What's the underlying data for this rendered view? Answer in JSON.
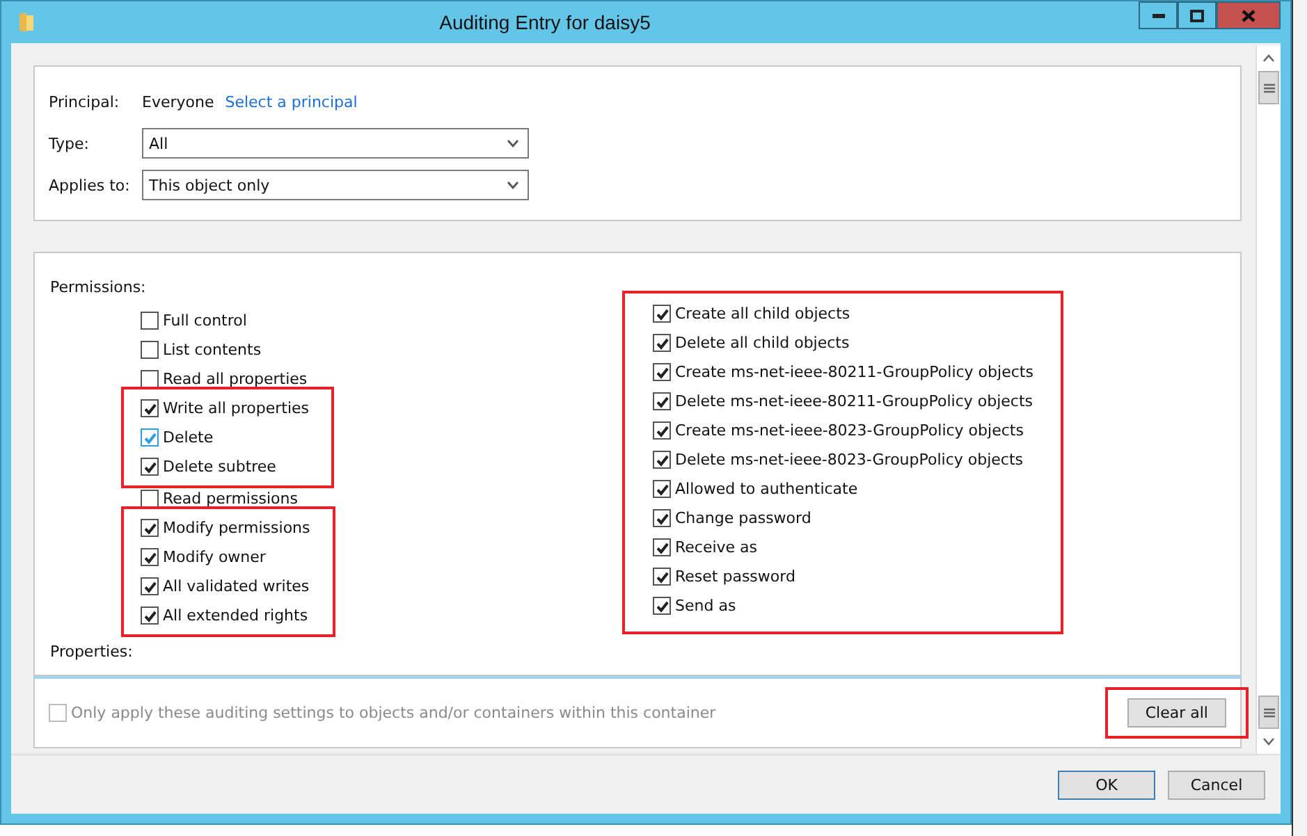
{
  "window": {
    "title": "Auditing Entry for daisy5"
  },
  "principal": {
    "label": "Principal:",
    "value": "Everyone",
    "link": "Select a principal"
  },
  "type": {
    "label": "Type:",
    "value": "All"
  },
  "applies_to": {
    "label": "Applies to:",
    "value": "This object only"
  },
  "permissions": {
    "heading": "Permissions:",
    "left_groups": [
      {
        "highlighted": false,
        "items": [
          {
            "label": "Full control",
            "checked": false,
            "focused": false
          },
          {
            "label": "List contents",
            "checked": false,
            "focused": false
          },
          {
            "label": "Read all properties",
            "checked": false,
            "focused": false
          }
        ]
      },
      {
        "highlighted": true,
        "items": [
          {
            "label": "Write all properties",
            "checked": true,
            "focused": false
          },
          {
            "label": "Delete",
            "checked": true,
            "focused": true
          },
          {
            "label": "Delete subtree",
            "checked": true,
            "focused": false
          }
        ]
      },
      {
        "highlighted": false,
        "items": [
          {
            "label": "Read permissions",
            "checked": false,
            "focused": false
          }
        ]
      },
      {
        "highlighted": true,
        "items": [
          {
            "label": "Modify permissions",
            "checked": true,
            "focused": false
          },
          {
            "label": "Modify owner",
            "checked": true,
            "focused": false
          },
          {
            "label": "All validated writes",
            "checked": true,
            "focused": false
          },
          {
            "label": "All extended rights",
            "checked": true,
            "focused": false
          }
        ]
      }
    ],
    "right_groups": [
      {
        "highlighted": true,
        "items": [
          {
            "label": "Create all child objects",
            "checked": true,
            "focused": false
          },
          {
            "label": "Delete all child objects",
            "checked": true,
            "focused": false
          },
          {
            "label": "Create ms-net-ieee-80211-GroupPolicy objects",
            "checked": true,
            "focused": false
          },
          {
            "label": "Delete ms-net-ieee-80211-GroupPolicy objects",
            "checked": true,
            "focused": false
          },
          {
            "label": "Create ms-net-ieee-8023-GroupPolicy objects",
            "checked": true,
            "focused": false
          },
          {
            "label": "Delete ms-net-ieee-8023-GroupPolicy objects",
            "checked": true,
            "focused": false
          },
          {
            "label": "Allowed to authenticate",
            "checked": true,
            "focused": false
          },
          {
            "label": "Change password",
            "checked": true,
            "focused": false
          },
          {
            "label": "Receive as",
            "checked": true,
            "focused": false
          },
          {
            "label": "Reset password",
            "checked": true,
            "focused": false
          },
          {
            "label": "Send as",
            "checked": true,
            "focused": false
          }
        ]
      }
    ]
  },
  "properties": {
    "heading": "Properties:"
  },
  "only_apply": {
    "label": "Only apply these auditing settings to objects and/or containers within this container",
    "checked": false,
    "disabled": true
  },
  "clear_all": {
    "label": "Clear all",
    "highlighted": true
  },
  "buttons": [
    "OK",
    "Cancel"
  ]
}
